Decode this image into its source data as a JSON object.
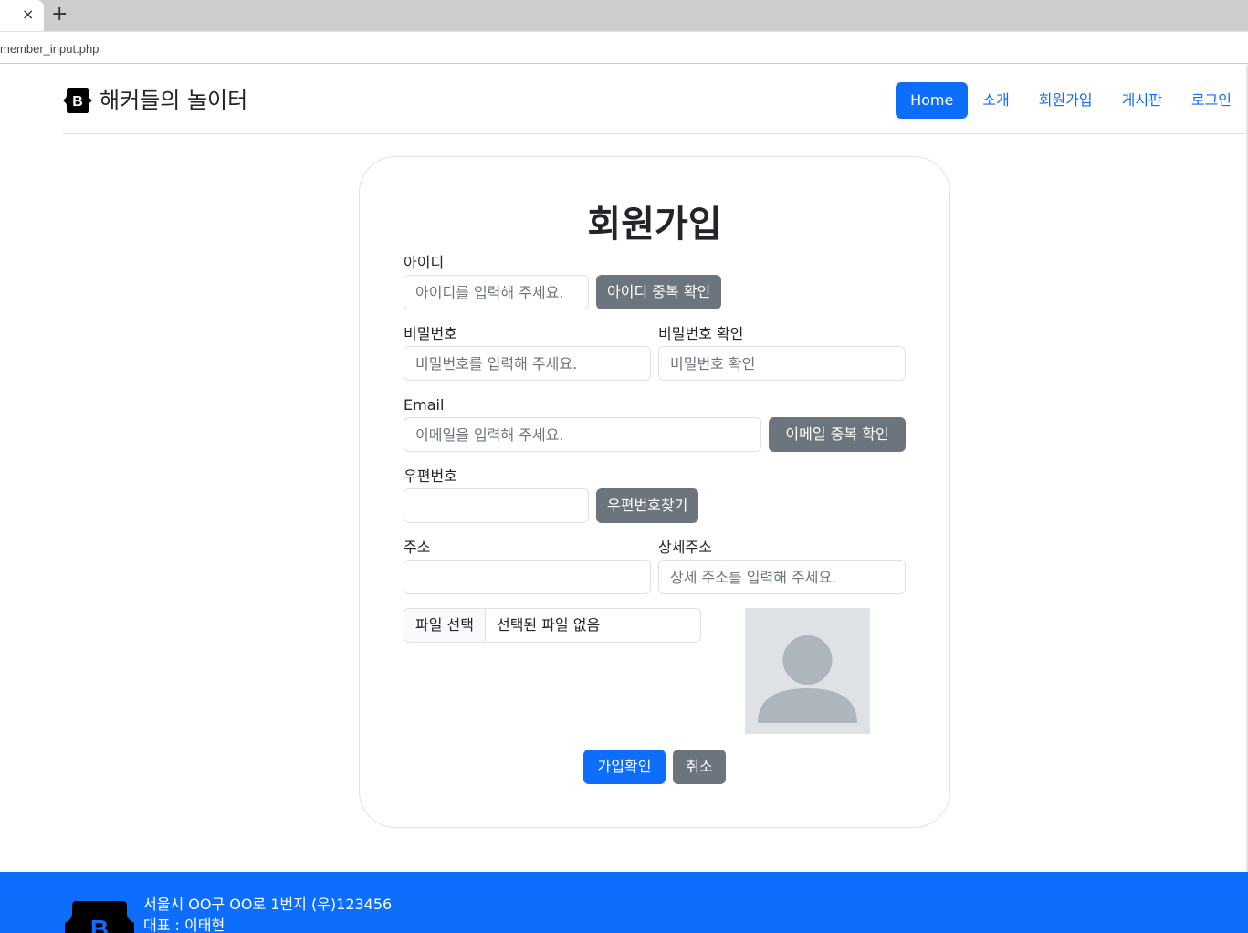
{
  "browser": {
    "tab_close": "×",
    "new_tab": "+",
    "url": "member_input.php"
  },
  "header": {
    "brand_letter": "B",
    "brand_title": "해커들의 놀이터",
    "nav": [
      {
        "label": "Home",
        "active": true
      },
      {
        "label": "소개",
        "active": false
      },
      {
        "label": "회원가입",
        "active": false
      },
      {
        "label": "게시판",
        "active": false
      },
      {
        "label": "로그인",
        "active": false
      }
    ]
  },
  "form": {
    "title": "회원가입",
    "id": {
      "label": "아이디",
      "placeholder": "아이디를 입력해 주세요.",
      "value": "",
      "check_button": "아이디 중복 확인"
    },
    "password": {
      "label": "비밀번호",
      "placeholder": "비밀번호를 입력해 주세요.",
      "value": ""
    },
    "password_confirm": {
      "label": "비밀번호 확인",
      "placeholder": "비밀번호 확인",
      "value": ""
    },
    "email": {
      "label": "Email",
      "placeholder": "이메일을 입력해 주세요.",
      "value": "",
      "check_button": "이메일 중복 확인"
    },
    "zipcode": {
      "label": "우편번호",
      "value": "",
      "search_button": "우편번호찾기"
    },
    "address": {
      "label": "주소",
      "value": ""
    },
    "address_detail": {
      "label": "상세주소",
      "placeholder": "상세 주소를 입력해 주세요.",
      "value": ""
    },
    "file": {
      "button_label": "파일 선택",
      "status": "선택된 파일 없음"
    },
    "avatar_icon": "person-placeholder-icon",
    "submit_button": "가입확인",
    "cancel_button": "취소"
  },
  "footer": {
    "address": "서울시 OO구 OO로 1번지 (우)123456",
    "representative": "대표 : 이태현"
  },
  "colors": {
    "primary": "#0d6efd",
    "secondary": "#6c757d",
    "border": "#dee2e6",
    "avatar_bg": "#dee2e6",
    "avatar_fg": "#adb5bd"
  }
}
